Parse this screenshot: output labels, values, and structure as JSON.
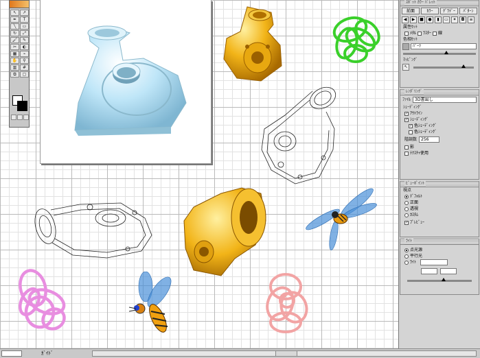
{
  "toolbox": {
    "tools": [
      "selection",
      "direct-select",
      "pen",
      "type",
      "line",
      "rect",
      "rotate",
      "scale",
      "brush",
      "pencil",
      "scissors",
      "blend",
      "gradient",
      "eyedropper",
      "hand",
      "zoom",
      "graph",
      "mesh",
      "slice",
      "artboard"
    ]
  },
  "statusbar": {
    "zoom": "",
    "status": "ｶﾞｲﾄﾞ"
  },
  "panels": {
    "top": {
      "title": "ｽﾎﾟｯﾄ ｶﾗｰ ﾊﾟﾚｯﾄ",
      "buttons": [
        "前面",
        "ｶﾗｰ",
        "ｸﾞﾗﾃﾞｰ",
        "ﾊﾟﾀｰﾝ"
      ],
      "section1": "属性ｾｯﾄ",
      "check1": "ﾒﾀﾙ",
      "check2": "ﾗｽﾀｰ",
      "check3": "線",
      "section2": "色相ｾｯﾄ",
      "field": "ﾊﾟｰﾂ",
      "section3": "ﾏｯﾋﾟﾝｸﾞ"
    },
    "render": {
      "title": "ﾚﾝﾀﾞﾘﾝｸﾞ",
      "file_label": "ﾌｧｲﾙ",
      "file_value": "3D書出し",
      "group": "ｼｪｰﾃﾞｨﾝｸﾞ",
      "opt1": "ｱｳﾄﾗｲﾝ",
      "opt2": "ｼｪｰﾃﾞｨﾝｸﾞ",
      "opt3": "色ｼｪｰﾃﾞｨﾝｸﾞ",
      "opt4": "色ｼｪｰﾃﾞｨﾝｸﾞ",
      "steps_label": "階調数",
      "steps_value": "256",
      "opt5": "影",
      "opt6": "ﾃｸｽﾁｬ使用"
    },
    "view": {
      "title": "ﾋﾞｭｰﾎﾟｲﾝﾄ",
      "group": "視点",
      "r1": "ﾃﾞﾌｫﾙﾄ",
      "r2": "正面",
      "r3": "透視",
      "r4": "ｶｽﾀﾑ",
      "check": "ﾌﾟﾚﾋﾞｭｰ"
    },
    "light": {
      "title": "ﾗｲﾄ",
      "r1": "点光源",
      "r2": "平行光",
      "r3": "ﾗｲﾄ"
    }
  },
  "colors": {
    "accent_gold": "#f2b418",
    "light_blue": "#bfe6f8",
    "green": "#3ad02a",
    "pink": "#e88ee0",
    "salmon": "#f2a4a4",
    "wing_blue": "#4a90d8"
  }
}
